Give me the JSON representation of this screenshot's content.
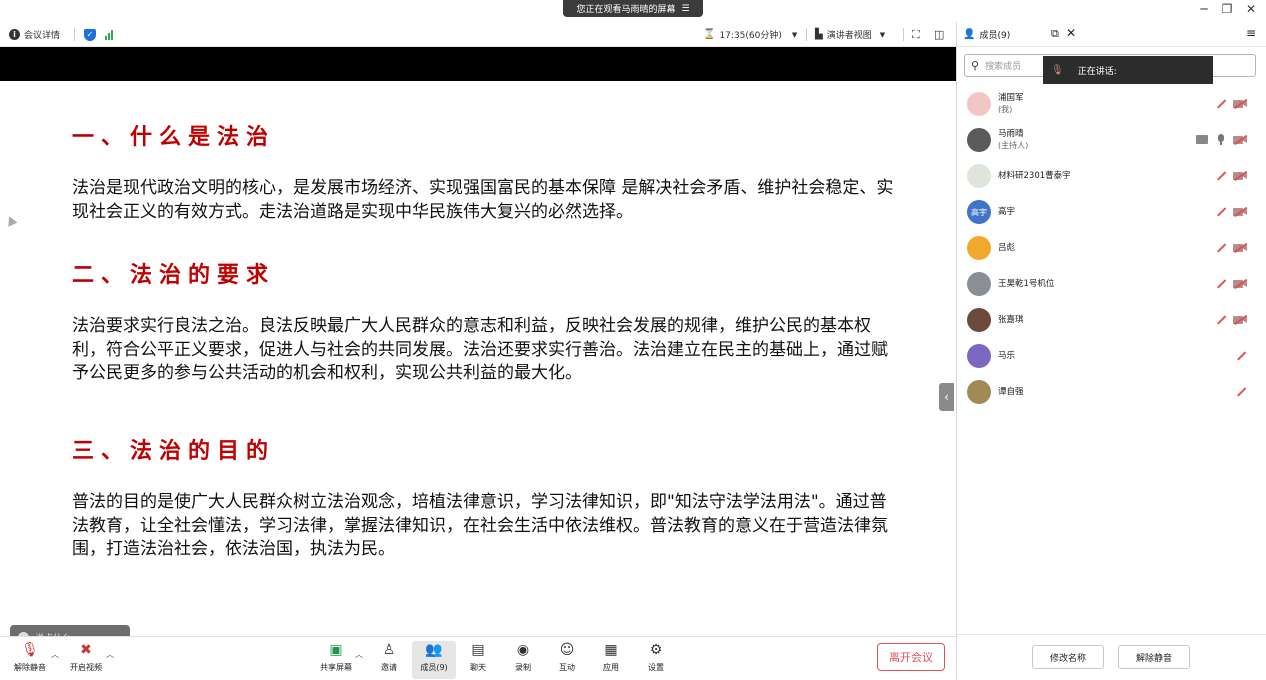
{
  "share_banner": {
    "label": "您正在观看马雨晴的屏幕",
    "menu_icon": "menu-lines-icon"
  },
  "window_controls": {
    "minimize": "─",
    "restore": "❐",
    "close": "✕"
  },
  "topbar": {
    "meeting_info": "会议详情",
    "timer": "17:35(60分钟)",
    "view_mode": "演讲者视图",
    "members_tab": "成员(9)"
  },
  "slide": {
    "heading1": "一、什么是法治",
    "para1": "法治是现代政治文明的核心，是发展市场经济、实现强国富民的基本保障 是解决社会矛盾、维护社会稳定、实现社会正义的有效方式。走法治道路是实现中华民族伟大复兴的必然选择。",
    "heading2": "二、法治的要求",
    "para2": "法治要求实行良法之治。良法反映最广大人民群众的意志和利益，反映社会发展的规律，维护公民的基本权利，符合公平正义要求，促进人与社会的共同发展。法治还要求实行善治。法治建立在民主的基础上，通过赋予公民更多的参与公共活动的机会和权利，实现公共利益的最大化。",
    "heading3": "三、法治的目的",
    "para3": "普法的目的是使广大人民群众树立法治观念，培植法律意识，学习法律知识，即\"知法守法学法用法\"。通过普法教育，让全社会懂法，学习法律，掌握法律知识，在社会生活中依法维权。普法教育的意义在于营造法律氛围，打造法治社会，依法治国，执法为民。"
  },
  "chat_input": {
    "placeholder": "说点什么..."
  },
  "bottombar": {
    "unmute": "解除静音",
    "start_video": "开启视频",
    "share_screen": "共享屏幕",
    "invite": "邀请",
    "members": "成员(9)",
    "chat": "聊天",
    "record": "录制",
    "interact": "互动",
    "apps": "应用",
    "settings": "设置",
    "leave": "离开会议"
  },
  "panel": {
    "search_placeholder": "搜索成员",
    "speaking_label": "正在讲话:",
    "members": [
      {
        "name": "浦国军",
        "role": "(我)",
        "avatar_color": "#f3c6c6",
        "avatar_text": ""
      },
      {
        "name": "马雨晴",
        "role": "(主持人)",
        "avatar_color": "#5a5a5a",
        "avatar_text": ""
      },
      {
        "name": "材料研2301曹泰宇",
        "role": "",
        "avatar_color": "#dfe5dc",
        "avatar_text": ""
      },
      {
        "name": "高宇",
        "role": "",
        "avatar_color": "#3f74c9",
        "avatar_text": "高宇"
      },
      {
        "name": "吕彪",
        "role": "",
        "avatar_color": "#f0a92c",
        "avatar_text": ""
      },
      {
        "name": "王昊乾1号机位",
        "role": "",
        "avatar_color": "#8a8f95",
        "avatar_text": ""
      },
      {
        "name": "张嘉琪",
        "role": "",
        "avatar_color": "#6b4a3c",
        "avatar_text": ""
      },
      {
        "name": "马乐",
        "role": "",
        "avatar_color": "#7c68c2",
        "avatar_text": ""
      },
      {
        "name": "谭自强",
        "role": "",
        "avatar_color": "#a08a55",
        "avatar_text": ""
      }
    ],
    "rename_button": "修改名称",
    "unmute_button": "解除静音"
  }
}
